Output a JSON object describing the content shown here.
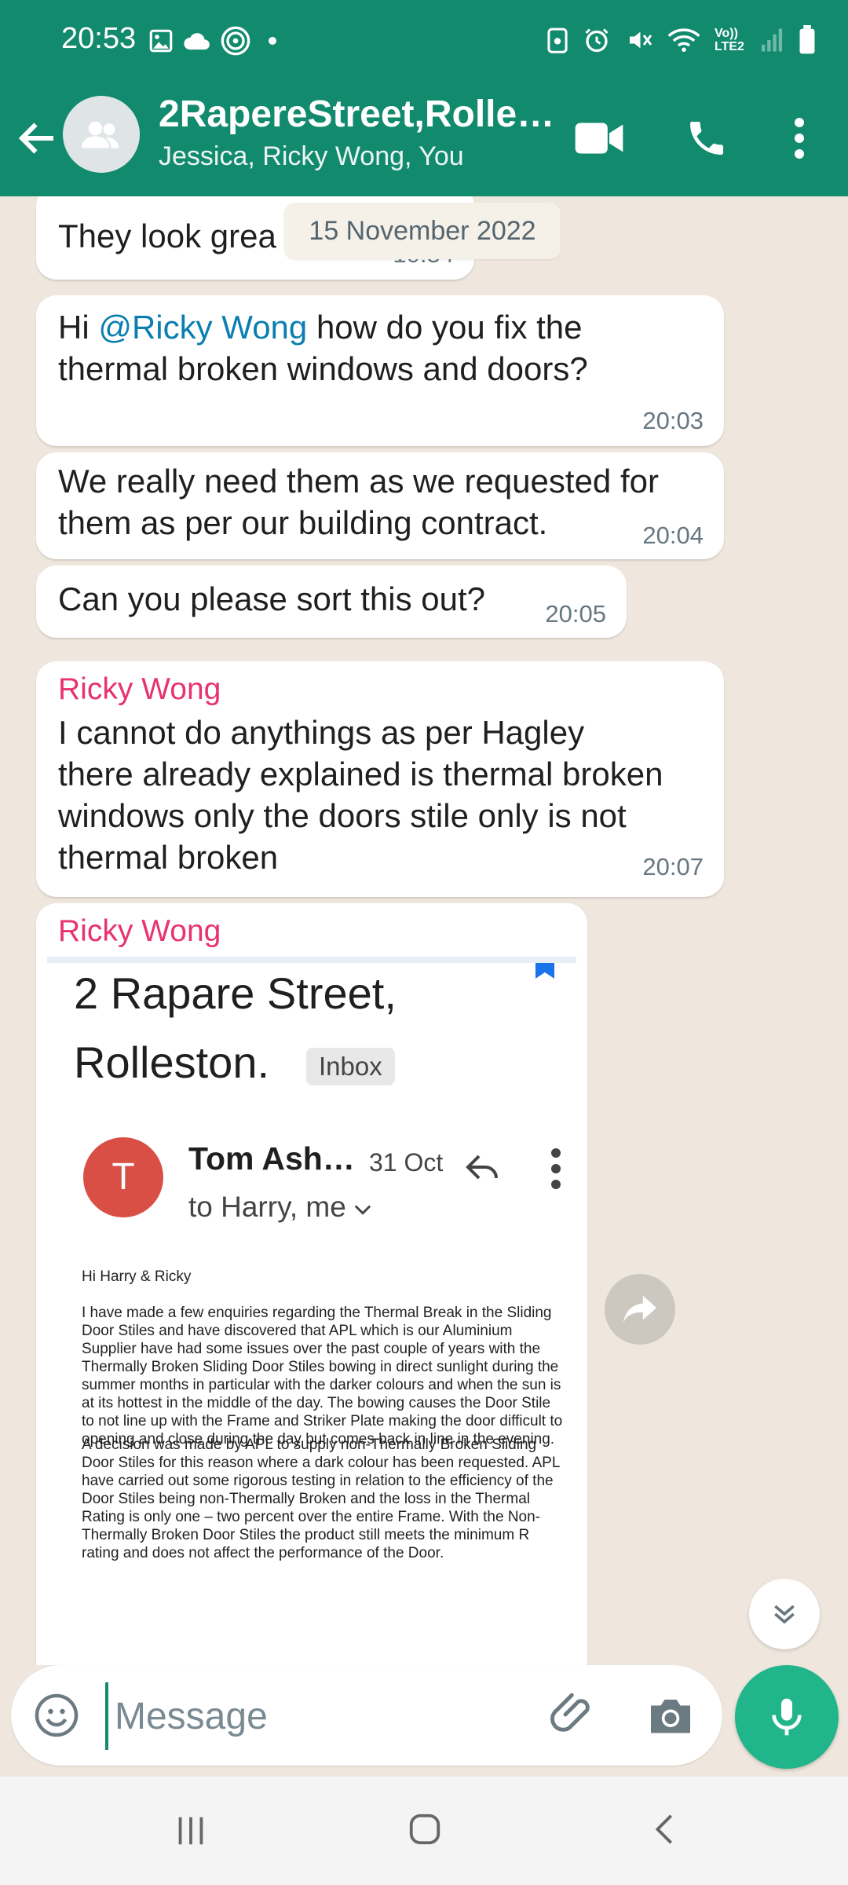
{
  "status_bar": {
    "time": "20:53",
    "network_label": "Vo)) LTE2"
  },
  "header": {
    "title": "2RapereStreet,Rolle…",
    "participants": "Jessica, Ricky Wong, You"
  },
  "date_chip": "15 November 2022",
  "messages": [
    {
      "text": "They look grea",
      "time": "10:34"
    },
    {
      "prefix": "Hi ",
      "mention": "@Ricky Wong",
      "text_line1": " how do you fix the",
      "text_line2": "thermal broken windows and doors?",
      "time": "20:03"
    },
    {
      "line1": "We really need them as we requested for",
      "line2": "them as per our building contract.",
      "time": "20:04"
    },
    {
      "text": "Can you please sort this out?",
      "time": "20:05"
    },
    {
      "sender": "Ricky Wong",
      "line1": "I cannot do anythings as per Hagley",
      "line2": "there already explained is thermal broken",
      "line3": "windows only the doors stile only is not",
      "line4": "thermal broken",
      "time": "20:07"
    },
    {
      "sender": "Ricky Wong"
    }
  ],
  "email": {
    "subject_line1": "2 Rapare Street,",
    "subject_line2": "Rolleston.",
    "inbox_label": "Inbox",
    "avatar_initial": "T",
    "sender": "Tom Ash…",
    "date": "31 Oct",
    "to": "to Harry, me",
    "greeting": "Hi Harry & Ricky",
    "para1": "I have made a few enquiries regarding the Thermal Break in the Sliding Door Stiles and have discovered that APL which is our Aluminium Supplier have had some issues over the past couple of years with the Thermally Broken Sliding Door Stiles bowing in direct sunlight during the summer months in particular with the darker colours and when the sun is at its hottest in the middle of the day. The bowing causes the Door Stile to not line up with the Frame and Striker Plate making the door difficult to opening and close during the day but comes back in line in the evening.",
    "para2": "A decision was made by APL to supply non-Thermally Broken Sliding Door Stiles for this reason where a dark colour has been requested. APL have carried out some rigorous testing in relation to the efficiency of the Door Stiles being non-Thermally Broken and the loss in the Thermal Rating is only one – two percent over the entire Frame. With the Non- Thermally Broken Door Stiles the product still meets the minimum R rating and does not affect the performance of the Door."
  },
  "composer": {
    "placeholder": "Message"
  },
  "colors": {
    "header": "#128a6e",
    "chat_background": "#efe7dd",
    "sender_name": "#e8336e",
    "mention": "#0b7eb0",
    "mic_button": "#21b58b"
  }
}
